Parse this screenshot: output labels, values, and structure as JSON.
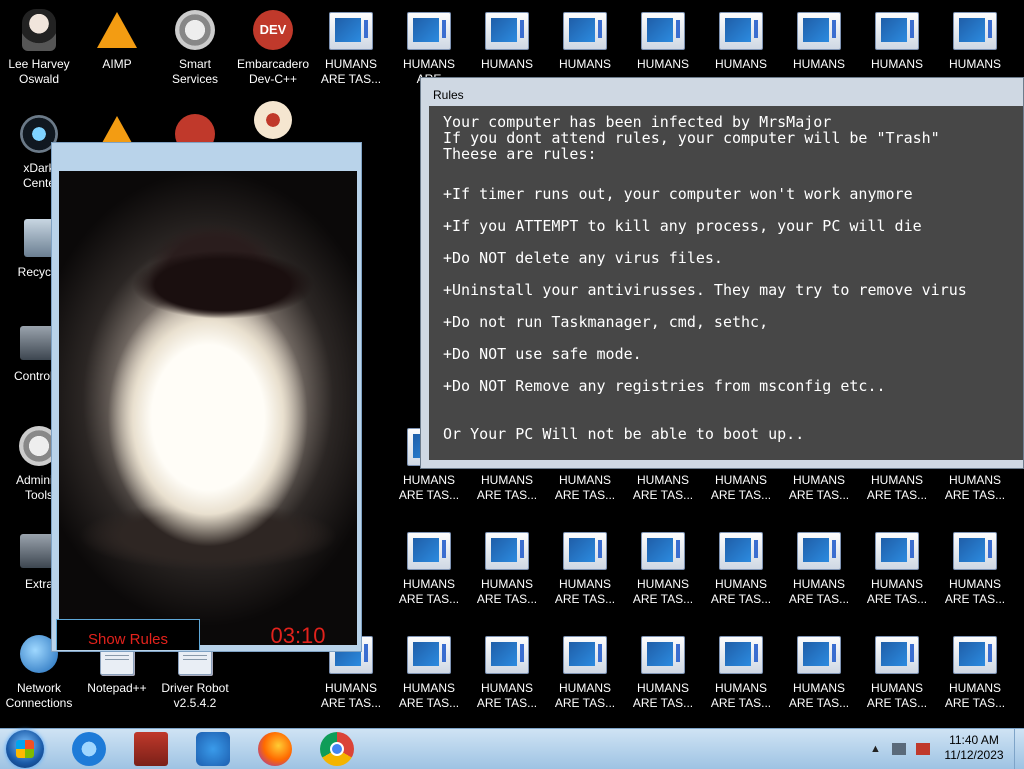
{
  "desktop": {
    "col1": [
      {
        "label1": "Lee Harvey",
        "label2": "Oswald",
        "icon": "avatar-icon"
      },
      {
        "label1": "xDark",
        "label2": "Cente",
        "icon": "xdark-icon"
      },
      {
        "label1": "Recycle",
        "label2": "",
        "icon": "recycle-bin-icon"
      },
      {
        "label1": "Control P",
        "label2": "",
        "icon": "control-panel-icon"
      },
      {
        "label1": "Administ",
        "label2": "Tools",
        "icon": "admin-tools-icon"
      },
      {
        "label1": "Extra",
        "label2": "",
        "icon": "folder-icon"
      },
      {
        "label1": "Network",
        "label2": "Connections",
        "icon": "network-icon"
      }
    ],
    "col2_top": {
      "label1": "AIMP",
      "label2": "",
      "icon": "aimp-icon"
    },
    "col2_bottom": {
      "label1": "Notepad++",
      "label2": "",
      "icon": "notepad-icon"
    },
    "col3_top": {
      "label1": "Smart",
      "label2": "Services",
      "icon": "gear-icon"
    },
    "col3_bottom": {
      "label1": "Driver Robot",
      "label2": "v2.5.4.2",
      "icon": "driver-robot-icon"
    },
    "col4_top": {
      "label1": "Embarcadero",
      "label2": "Dev-C++",
      "icon": "dev-cpp-icon"
    },
    "humans_label1": "HUMANS",
    "humans_label2": "ARE TAS...",
    "humans_label2_short": "ARE",
    "humans_label2_cut": "S...",
    "humans_label_cut_ns": "NS",
    "humans_label_hu": "HU"
  },
  "rules_window": {
    "title": "Rules",
    "lines": [
      "Your computer has been infected by MrsMajor",
      "If you dont attend rules, your computer will be \"Trash\"",
      "Theese are rules:",
      "+If timer runs out, your computer won't work anymore",
      "+If you ATTEMPT to kill any process, your PC will die",
      "+Do NOT delete any virus files.",
      "+Uninstall your antivirusses. They may try to remove virus",
      "+Do not run Taskmanager, cmd, sethc,",
      "+Do NOT use safe mode.",
      "+Do NOT Remove any registries from msconfig etc..",
      "Or Your PC Will not be able to boot up.."
    ]
  },
  "image_window": {
    "show_rules_label": "Show Rules",
    "timer": "03:10"
  },
  "taskbar": {
    "time": "11:40 AM",
    "date": "11/12/2023",
    "tray_arrow": "▲",
    "apps": [
      "start-orb",
      "internet-explorer-icon",
      "winrar-icon",
      "music-player-icon",
      "firefox-icon",
      "chrome-icon"
    ]
  }
}
